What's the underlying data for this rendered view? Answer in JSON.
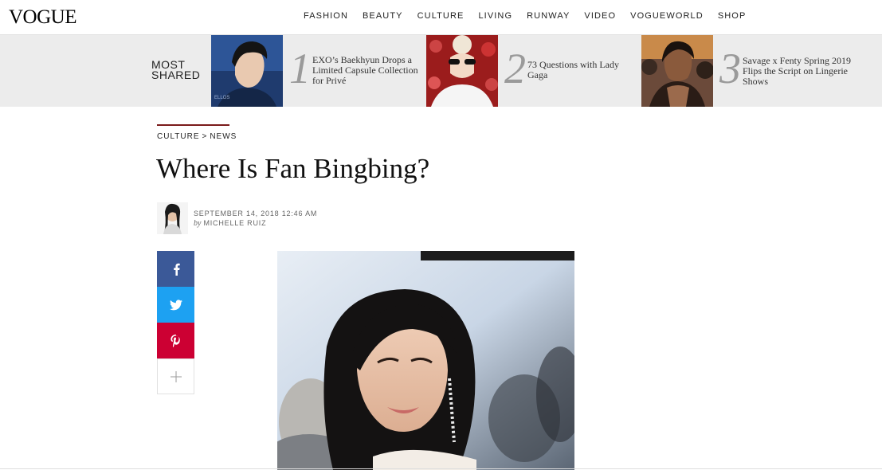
{
  "header": {
    "logo": "VOGUE",
    "nav": [
      "FASHION",
      "BEAUTY",
      "CULTURE",
      "LIVING",
      "RUNWAY",
      "VIDEO",
      "VOGUEWORLD",
      "SHOP"
    ]
  },
  "most_shared": {
    "title_line1": "MOST",
    "title_line2": "SHARED",
    "items": [
      {
        "number": "1",
        "title": "EXO’s Baekhyun Drops a Limited Capsule Collection for Privé",
        "thumb": "man-portrait-photo"
      },
      {
        "number": "2",
        "title": "73 Questions with Lady Gaga",
        "thumb": "lady-gaga-photo"
      },
      {
        "number": "3",
        "title": "Savage x Fenty Spring 2019 Flips the Script on Lingerie Shows",
        "thumb": "rihanna-photo"
      }
    ]
  },
  "article": {
    "breadcrumb_section": "CULTURE",
    "breadcrumb_sep": ">",
    "breadcrumb_sub": "NEWS",
    "headline": "Where Is Fan Bingbing?",
    "date": "SEPTEMBER 14, 2018 12:46 AM",
    "by": "by",
    "author": "MICHELLE RUIZ"
  },
  "share": {
    "icons": [
      "facebook-icon",
      "twitter-icon",
      "pinterest-icon",
      "plus-icon"
    ]
  },
  "colors": {
    "facebook": "#3b5998",
    "twitter": "#1da1f2",
    "pinterest": "#cc0033",
    "accent_rule": "#7a1a1a",
    "strip_bg": "#ececec"
  }
}
